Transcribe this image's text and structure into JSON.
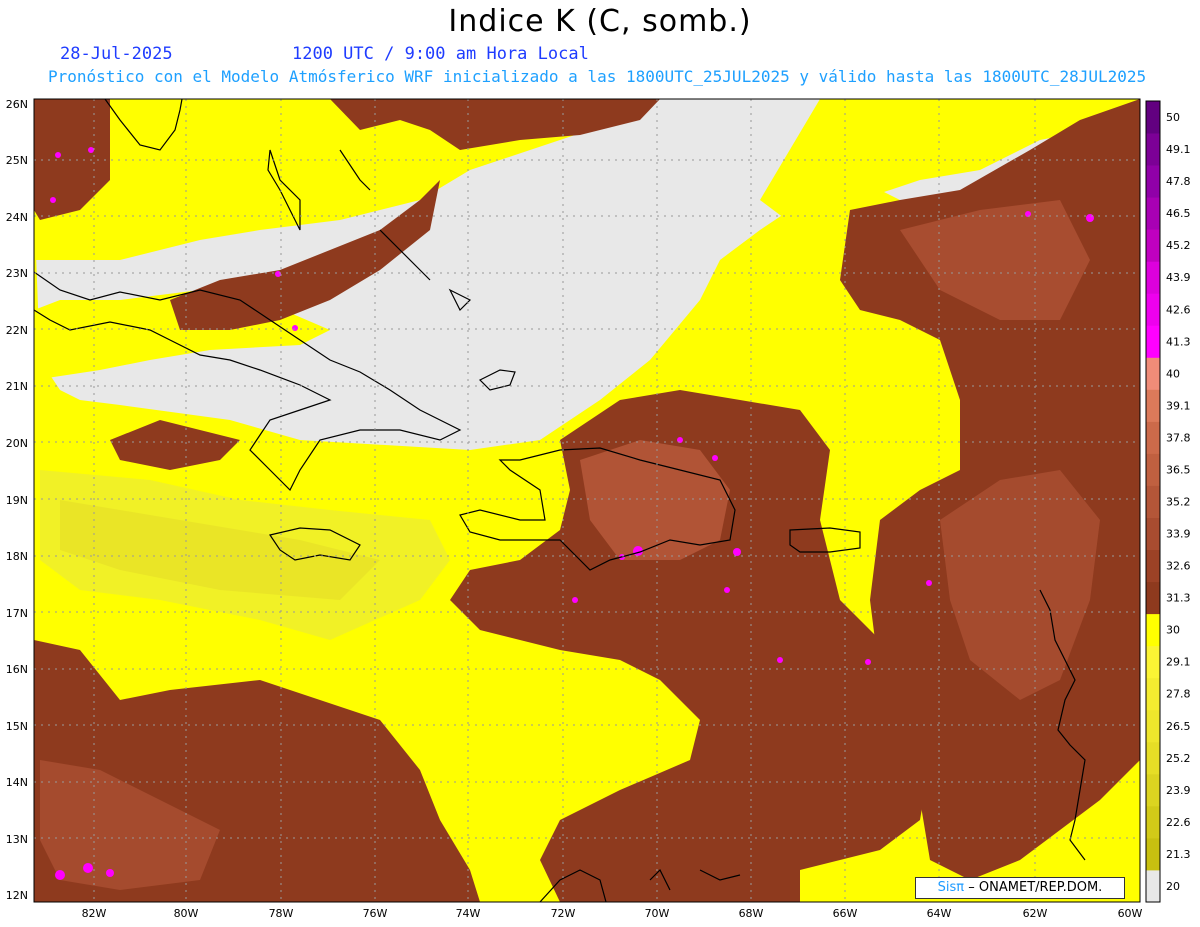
{
  "header": {
    "title": "Indice K (C, somb.)",
    "date": "28-Jul-2025",
    "time": "1200 UTC / 9:00 am Hora Local",
    "description": "Pronóstico con el Modelo Atmósferico WRF inicializado a las 1800UTC_25JUL2025 y válido hasta las  1800UTC_28JUL2025"
  },
  "axes": {
    "lat_labels": [
      "26N",
      "25N",
      "24N",
      "23N",
      "22N",
      "21N",
      "20N",
      "19N",
      "18N",
      "17N",
      "16N",
      "15N",
      "14N",
      "13N",
      "12N"
    ],
    "lon_labels": [
      "82W",
      "80W",
      "78W",
      "76W",
      "74W",
      "72W",
      "70W",
      "68W",
      "66W",
      "64W",
      "62W",
      "60W"
    ]
  },
  "colorbar": {
    "levels": [
      "20",
      "21.3",
      "22.6",
      "23.9",
      "25.2",
      "26.5",
      "27.8",
      "29.1",
      "30",
      "31.3",
      "32.6",
      "33.9",
      "35.2",
      "36.5",
      "37.8",
      "39.1",
      "40",
      "41.3",
      "42.6",
      "43.9",
      "45.2",
      "46.5",
      "47.8",
      "49.1",
      "50"
    ],
    "colors": [
      "#e8e8e8",
      "#c8c010",
      "#d2ca18",
      "#dcd420",
      "#e6de26",
      "#eee62c",
      "#f4ec30",
      "#fbf434",
      "#ffff00",
      "#8e3a1e",
      "#9c4226",
      "#a84c30",
      "#b45638",
      "#c06040",
      "#cc6a4a",
      "#dc7a5a",
      "#f08c78",
      "#ff00ff",
      "#ee00ee",
      "#dd00dd",
      "#c000c0",
      "#a800b4",
      "#9000a8",
      "#7c0096",
      "#620080"
    ]
  },
  "map_colors": {
    "background": "#e8e8e8",
    "low": "#eeee30",
    "mid": "#ffff00",
    "high": "#8e3a1e",
    "higher": "#b45638",
    "highest": "#ff00ff",
    "coast": "#000000",
    "grid": "#999999"
  },
  "credit": {
    "brand": "Sisπ",
    "text": "– ONAMET/REP.DOM."
  }
}
